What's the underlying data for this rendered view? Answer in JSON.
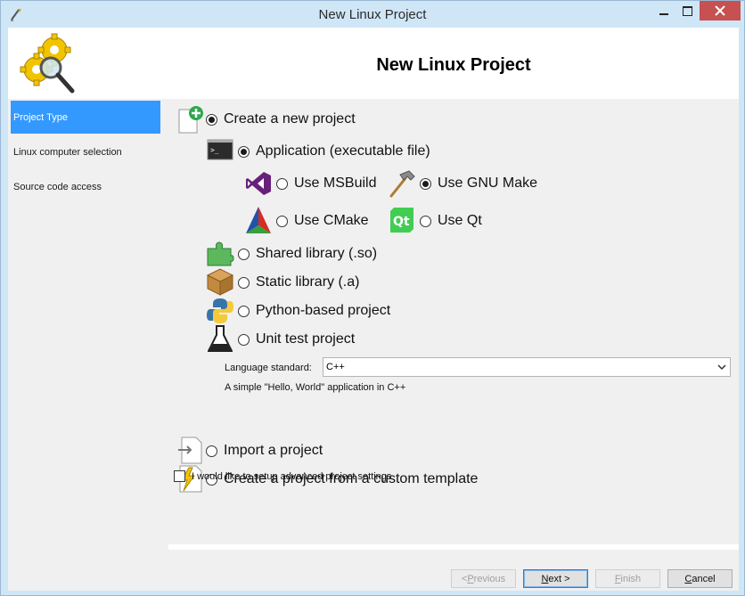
{
  "window": {
    "title": "New Linux Project",
    "controls": {
      "minimize": "–",
      "maximize": "□",
      "close": "✕"
    }
  },
  "header": {
    "title": "New Linux Project"
  },
  "sidebar": {
    "items": [
      {
        "label": "Project Type",
        "active": true
      },
      {
        "label": "Linux computer selection",
        "active": false
      },
      {
        "label": "Source code access",
        "active": false
      }
    ]
  },
  "options": {
    "create_new": "Create a new project",
    "application": "Application (executable file)",
    "use_msbuild": "Use MSBuild",
    "use_gnu_make": "Use GNU Make",
    "use_cmake": "Use CMake",
    "use_qt": "Use Qt",
    "shared_library": "Shared library (.so)",
    "static_library": "Static library (.a)",
    "python_project": "Python-based project",
    "unit_test": "Unit test project",
    "import_project": "Import a project",
    "custom_template": "Create a project from a custom template"
  },
  "language": {
    "label": "Language standard:",
    "selected": "C++",
    "description": "A simple \"Hello, World\" application in C++"
  },
  "advanced": {
    "label": "I would like to setup advanced project settings",
    "checked": false
  },
  "buttons": {
    "previous_prefix": "< ",
    "previous_key": "P",
    "previous_rest": "revious",
    "next_key": "N",
    "next_rest": "ext >",
    "finish_key": "F",
    "finish_rest": "inish",
    "cancel_key": "C",
    "cancel_rest": "ancel"
  },
  "colors": {
    "selection": "#3399ff",
    "titlebar": "#cfe6f7",
    "close_button": "#c75050"
  }
}
